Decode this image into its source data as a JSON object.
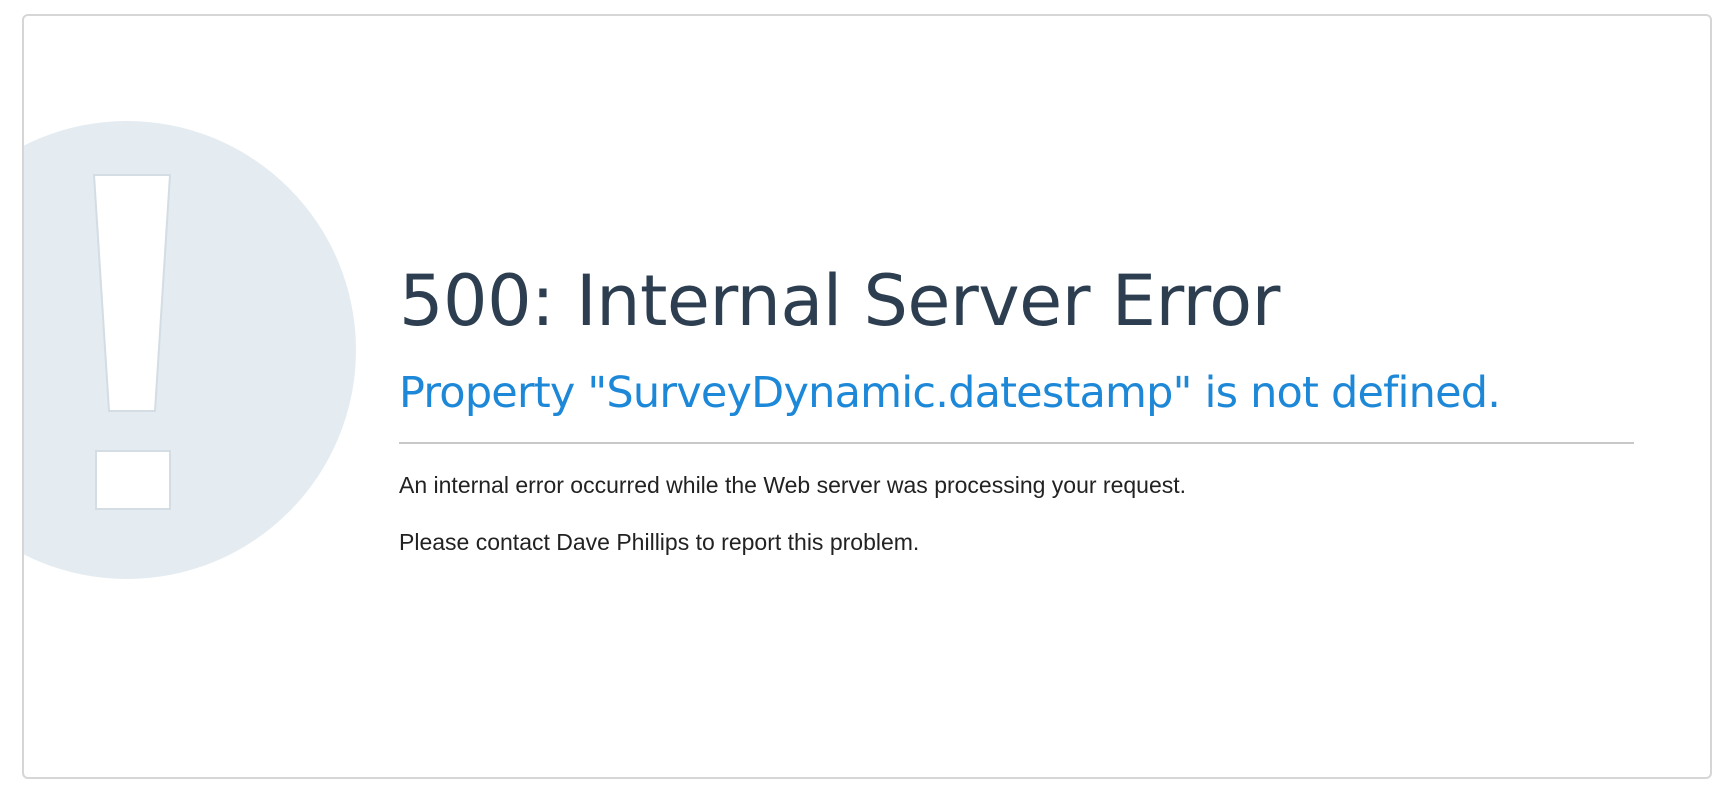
{
  "error": {
    "icon": "exclamation-circle-icon",
    "title": "500: Internal Server Error",
    "subtitle": "Property \"SurveyDynamic.datestamp\" is not defined.",
    "message": "An internal error occurred while the Web server was processing your request.",
    "contact": "Please contact Dave Phillips to report this problem."
  },
  "colors": {
    "title": "#2c3e50",
    "subtitle": "#1e88d8",
    "icon_circle": "#e4ecf1",
    "divider": "#c8c8c8"
  }
}
